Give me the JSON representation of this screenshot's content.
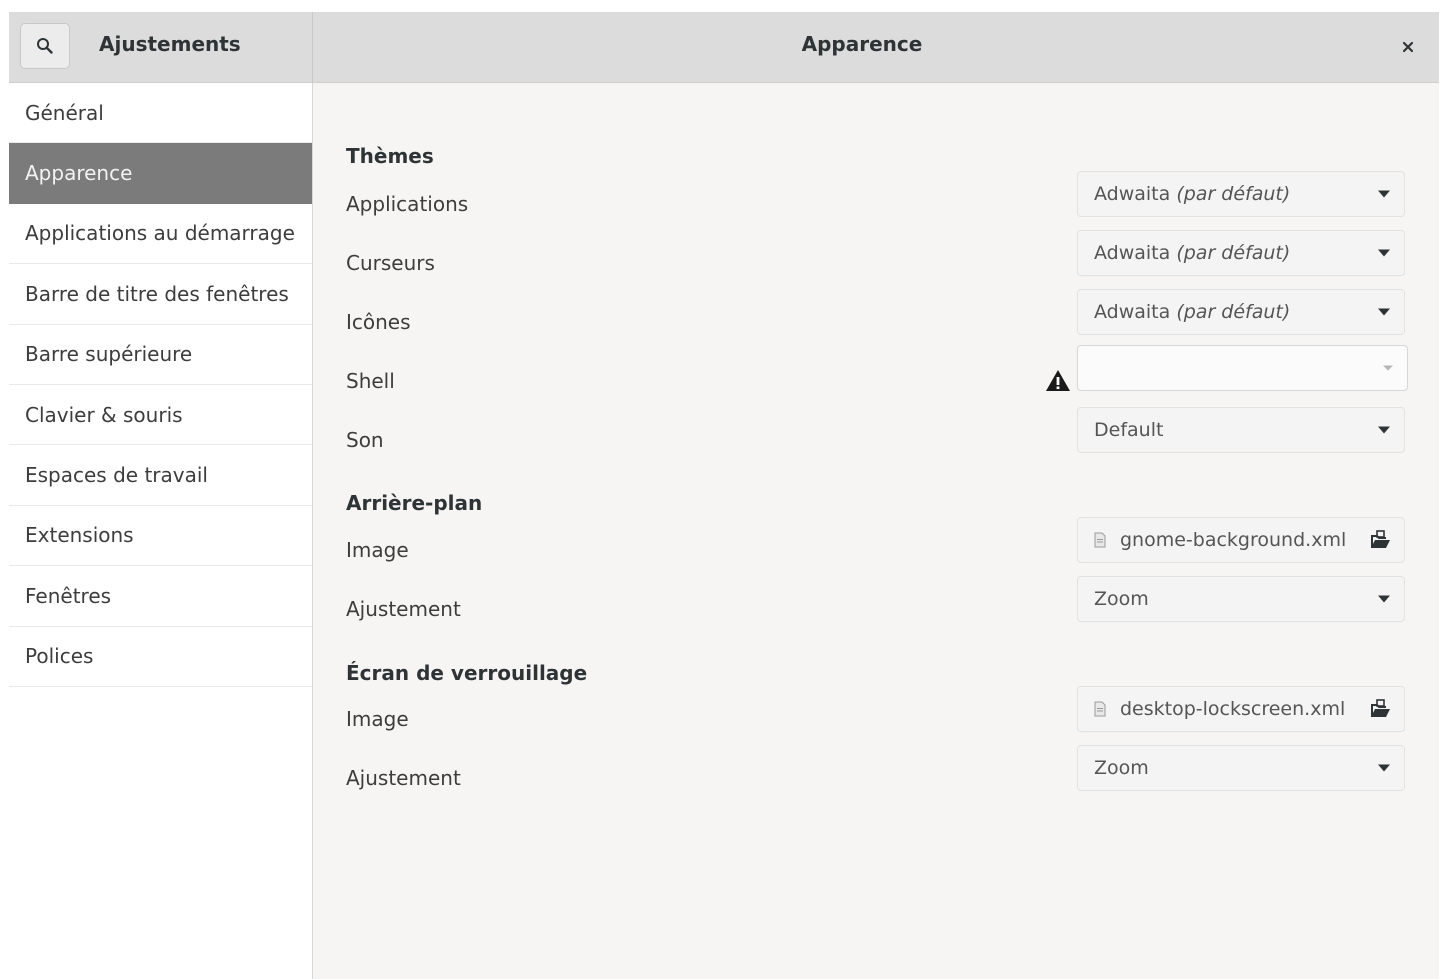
{
  "header": {
    "left_title": "Ajustements",
    "center_title": "Apparence",
    "close_label": "×"
  },
  "sidebar": {
    "items": [
      {
        "label": "Général"
      },
      {
        "label": "Apparence",
        "selected": true
      },
      {
        "label": "Applications au démarrage"
      },
      {
        "label": "Barre de titre des fenêtres"
      },
      {
        "label": "Barre supérieure"
      },
      {
        "label": "Clavier & souris"
      },
      {
        "label": "Espaces de travail"
      },
      {
        "label": "Extensions"
      },
      {
        "label": "Fenêtres"
      },
      {
        "label": "Polices"
      }
    ]
  },
  "themes": {
    "header": "Thèmes",
    "applications": {
      "label": "Applications",
      "value": "Adwaita ",
      "value_suffix": "(par défaut)"
    },
    "cursors": {
      "label": "Curseurs",
      "value": "Adwaita ",
      "value_suffix": "(par défaut)"
    },
    "icons": {
      "label": "Icônes",
      "value": "Adwaita ",
      "value_suffix": "(par défaut)"
    },
    "shell": {
      "label": "Shell",
      "value": "",
      "warning_icon": "warning-icon"
    },
    "sound": {
      "label": "Son",
      "value": "Default"
    }
  },
  "background": {
    "header": "Arrière-plan",
    "image": {
      "label": "Image",
      "file": "gnome-background.xml"
    },
    "adjustment": {
      "label": "Ajustement",
      "value": "Zoom"
    }
  },
  "lockscreen": {
    "header": "Écran de verrouillage",
    "image": {
      "label": "Image",
      "file": "desktop-lockscreen.xml"
    },
    "adjustment": {
      "label": "Ajustement",
      "value": "Zoom"
    }
  },
  "icons": {
    "search": "search-icon",
    "close": "close-icon",
    "warning": "warning-icon",
    "file": "file-icon",
    "open": "document-open-icon",
    "dropdown": "dropdown-arrow-icon"
  },
  "colors": {
    "sidebar_selected_bg": "#7b7b7b",
    "header_bg": "#dcdcdc",
    "content_bg": "#f6f5f4"
  }
}
